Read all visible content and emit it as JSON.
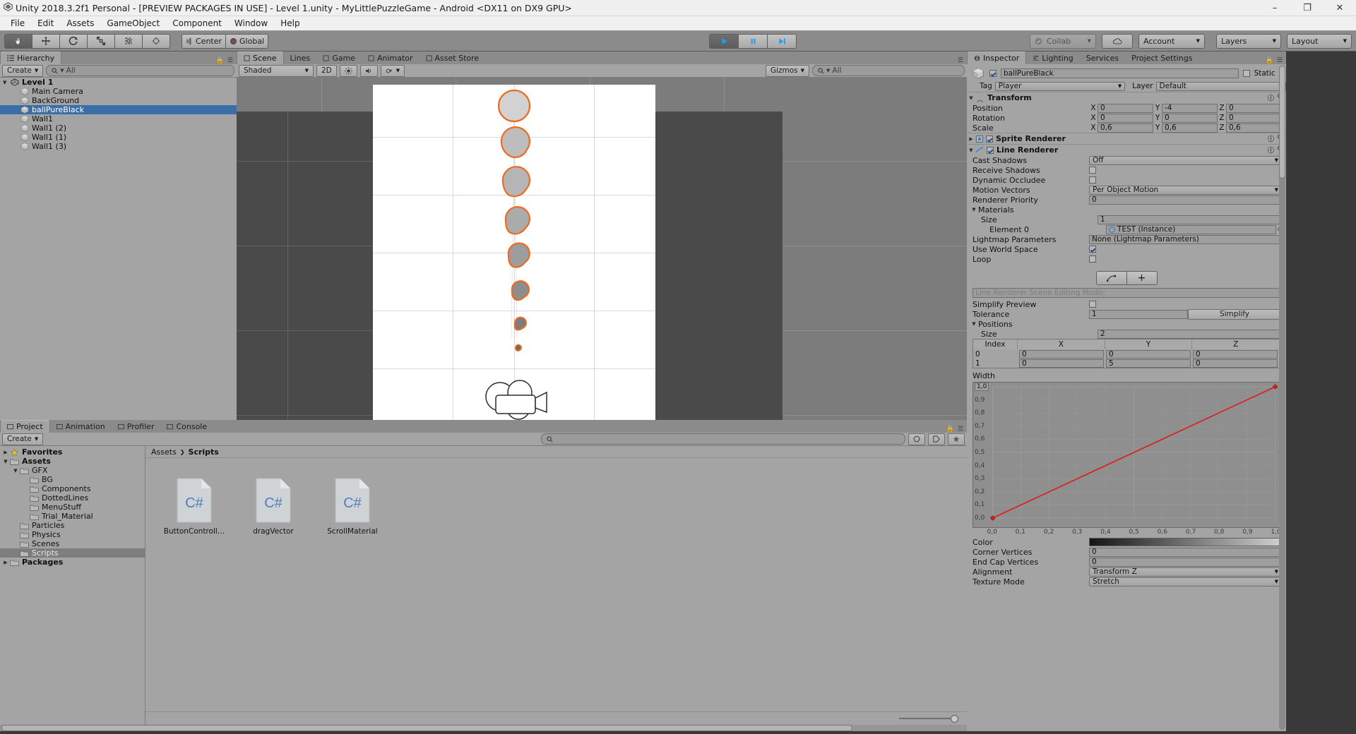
{
  "window": {
    "title": "Unity 2018.3.2f1 Personal - [PREVIEW PACKAGES IN USE] - Level 1.unity - MyLittlePuzzleGame - Android <DX11 on DX9 GPU>",
    "minimize": "–",
    "maximize": "❐",
    "close": "✕"
  },
  "menu": [
    "File",
    "Edit",
    "Assets",
    "GameObject",
    "Component",
    "Window",
    "Help"
  ],
  "toolbar": {
    "tools": [
      "hand-tool",
      "move-tool",
      "rotate-tool",
      "scale-tool",
      "rect-tool",
      "transform-tool"
    ],
    "pivot": "Center",
    "handle": "Global",
    "play": "play-button",
    "pause": "pause-button",
    "step": "step-button",
    "collab": "Collab",
    "cloud": "cloud-icon",
    "account": "Account",
    "layers": "Layers",
    "layout": "Layout"
  },
  "hierarchy": {
    "tab": "Hierarchy",
    "create": "Create",
    "search_placeholder": "All",
    "items": [
      {
        "label": "Level 1",
        "depth": 0,
        "bold": true,
        "arrow": "▼",
        "selected": false,
        "icon": "scene-icon"
      },
      {
        "label": "Main Camera",
        "depth": 1,
        "bold": false,
        "arrow": "",
        "selected": false,
        "icon": "gameobject-icon"
      },
      {
        "label": "BackGround",
        "depth": 1,
        "bold": false,
        "arrow": "",
        "selected": false,
        "icon": "gameobject-icon"
      },
      {
        "label": "ballPureBlack",
        "depth": 1,
        "bold": false,
        "arrow": "",
        "selected": true,
        "icon": "gameobject-icon"
      },
      {
        "label": "Wall1",
        "depth": 1,
        "bold": false,
        "arrow": "",
        "selected": false,
        "icon": "gameobject-icon"
      },
      {
        "label": "Wall1 (2)",
        "depth": 1,
        "bold": false,
        "arrow": "",
        "selected": false,
        "icon": "gameobject-icon"
      },
      {
        "label": "Wall1 (1)",
        "depth": 1,
        "bold": false,
        "arrow": "",
        "selected": false,
        "icon": "gameobject-icon"
      },
      {
        "label": "Wall1 (3)",
        "depth": 1,
        "bold": false,
        "arrow": "",
        "selected": false,
        "icon": "gameobject-icon"
      }
    ]
  },
  "scene": {
    "tabs": [
      {
        "label": "Scene",
        "selected": true,
        "icon": "scene-tab-icon"
      },
      {
        "label": "Lines",
        "selected": false,
        "icon": ""
      },
      {
        "label": "Game",
        "selected": false,
        "icon": "game-tab-icon"
      },
      {
        "label": "Animator",
        "selected": false,
        "icon": "animator-tab-icon"
      },
      {
        "label": "Asset Store",
        "selected": false,
        "icon": "store-tab-icon"
      }
    ],
    "shading": "Shaded",
    "mode_2d": "2D",
    "lighting_icon": "sun-icon",
    "audio_icon": "speaker-icon",
    "effects_icon": "fx-icon",
    "gizmos": "Gizmos",
    "search_placeholder": "All"
  },
  "inspector": {
    "tabs": [
      {
        "label": "Inspector",
        "selected": true,
        "icon": "info-icon"
      },
      {
        "label": "Lighting",
        "selected": false,
        "icon": "lighting-icon"
      },
      {
        "label": "Services",
        "selected": false,
        "icon": ""
      },
      {
        "label": "Project Settings",
        "selected": false,
        "icon": ""
      }
    ],
    "object_name": "ballPureBlack",
    "object_enabled": true,
    "static_label": "Static",
    "tag_label": "Tag",
    "tag_value": "Player",
    "layer_label": "Layer",
    "layer_value": "Default",
    "transform": {
      "title": "Transform",
      "rows": [
        {
          "label": "Position",
          "x": "0",
          "y": "-4",
          "z": "0"
        },
        {
          "label": "Rotation",
          "x": "0",
          "y": "0",
          "z": "0"
        },
        {
          "label": "Scale",
          "x": "0,6",
          "y": "0,6",
          "z": "0,6"
        }
      ]
    },
    "sprite_renderer": {
      "title": "Sprite Renderer",
      "enabled": true
    },
    "line_renderer": {
      "title": "Line Renderer",
      "enabled": true,
      "cast_shadows_label": "Cast Shadows",
      "cast_shadows_value": "Off",
      "receive_shadows_label": "Receive Shadows",
      "receive_shadows_value": false,
      "dynamic_occludee_label": "Dynamic Occludee",
      "dynamic_occludee_value": false,
      "motion_vectors_label": "Motion Vectors",
      "motion_vectors_value": "Per Object Motion",
      "renderer_priority_label": "Renderer Priority",
      "renderer_priority_value": "0",
      "materials_label": "Materials",
      "materials_size_label": "Size",
      "materials_size_value": "1",
      "element0_label": "Element 0",
      "element0_value": "TEST (Instance)",
      "lightmap_label": "Lightmap Parameters",
      "lightmap_value": "None (Lightmap Parameters)",
      "use_world_space_label": "Use World Space",
      "use_world_space_value": true,
      "loop_label": "Loop",
      "loop_value": false,
      "edit_mode_placeholder": "Line Renderer Scene Editing Mode:",
      "simplify_preview_label": "Simplify Preview",
      "simplify_preview_value": false,
      "tolerance_label": "Tolerance",
      "tolerance_value": "1",
      "simplify_button": "Simplify",
      "positions_label": "Positions",
      "positions_size_label": "Size",
      "positions_size_value": "2",
      "positions_columns": [
        "Index",
        "X",
        "Y",
        "Z"
      ],
      "positions_rows": [
        {
          "index": "0",
          "x": "0",
          "y": "0",
          "z": "0"
        },
        {
          "index": "1",
          "x": "0",
          "y": "5",
          "z": "0"
        }
      ],
      "width_label": "Width",
      "color_label": "Color",
      "corner_vertices_label": "Corner Vertices",
      "corner_vertices_value": "0",
      "end_cap_vertices_label": "End Cap Vertices",
      "end_cap_vertices_value": "0",
      "alignment_label": "Alignment",
      "alignment_value": "Transform Z",
      "texture_mode_label": "Texture Mode",
      "texture_mode_value": "Stretch"
    }
  },
  "chart_data": {
    "type": "line",
    "title": "Width",
    "x": [
      0.0,
      1.0
    ],
    "values": [
      0.0,
      1.0
    ],
    "xlabel": "",
    "ylabel": "",
    "xlim": [
      0.0,
      1.0
    ],
    "ylim": [
      0.0,
      1.0
    ],
    "xticks": [
      "0,0",
      "0,1",
      "0,2",
      "0,3",
      "0,4",
      "0,5",
      "0,6",
      "0,7",
      "0,8",
      "0,9",
      "1,0"
    ],
    "yticks": [
      "0,0",
      "0,1",
      "0,2",
      "0,3",
      "0,4",
      "0,5",
      "0,6",
      "0,7",
      "0,8",
      "0,9",
      "1,0"
    ],
    "line_color": "#e01b1b",
    "grid": true,
    "keyframes": [
      {
        "time": 0.0,
        "value": 0.0
      },
      {
        "time": 1.0,
        "value": 1.0
      }
    ]
  },
  "project": {
    "tabs": [
      {
        "label": "Project",
        "selected": true,
        "icon": "folder-icon"
      },
      {
        "label": "Animation",
        "selected": false,
        "icon": "clock-icon"
      },
      {
        "label": "Profiler",
        "selected": false,
        "icon": "profiler-icon"
      },
      {
        "label": "Console",
        "selected": false,
        "icon": "console-icon"
      }
    ],
    "create": "Create",
    "search_placeholder": "",
    "tree": [
      {
        "label": "Favorites",
        "depth": 0,
        "arrow": "▶",
        "bold": true,
        "icon": "star-icon",
        "selected": false
      },
      {
        "label": "Assets",
        "depth": 0,
        "arrow": "▼",
        "bold": true,
        "icon": "folder-icon",
        "selected": false
      },
      {
        "label": "GFX",
        "depth": 1,
        "arrow": "▼",
        "bold": false,
        "icon": "folder-icon",
        "selected": false
      },
      {
        "label": "BG",
        "depth": 2,
        "arrow": "",
        "bold": false,
        "icon": "folder-icon",
        "selected": false
      },
      {
        "label": "Components",
        "depth": 2,
        "arrow": "",
        "bold": false,
        "icon": "folder-icon",
        "selected": false
      },
      {
        "label": "DottedLines",
        "depth": 2,
        "arrow": "",
        "bold": false,
        "icon": "folder-icon",
        "selected": false
      },
      {
        "label": "MenuStuff",
        "depth": 2,
        "arrow": "",
        "bold": false,
        "icon": "folder-icon",
        "selected": false
      },
      {
        "label": "Trial_Material",
        "depth": 2,
        "arrow": "",
        "bold": false,
        "icon": "folder-icon",
        "selected": false
      },
      {
        "label": "Particles",
        "depth": 1,
        "arrow": "",
        "bold": false,
        "icon": "folder-icon",
        "selected": false
      },
      {
        "label": "Physics",
        "depth": 1,
        "arrow": "",
        "bold": false,
        "icon": "folder-icon",
        "selected": false
      },
      {
        "label": "Scenes",
        "depth": 1,
        "arrow": "",
        "bold": false,
        "icon": "folder-icon",
        "selected": false
      },
      {
        "label": "Scripts",
        "depth": 1,
        "arrow": "",
        "bold": false,
        "icon": "folder-icon",
        "selected": true
      },
      {
        "label": "Packages",
        "depth": 0,
        "arrow": "▶",
        "bold": true,
        "icon": "folder-icon",
        "selected": false
      }
    ],
    "breadcrumb": [
      "Assets",
      "Scripts"
    ],
    "assets": [
      {
        "label": "ButtonControll…",
        "type": "C#"
      },
      {
        "label": "dragVector",
        "type": "C#"
      },
      {
        "label": "ScrollMaterial",
        "type": "C#"
      }
    ]
  }
}
